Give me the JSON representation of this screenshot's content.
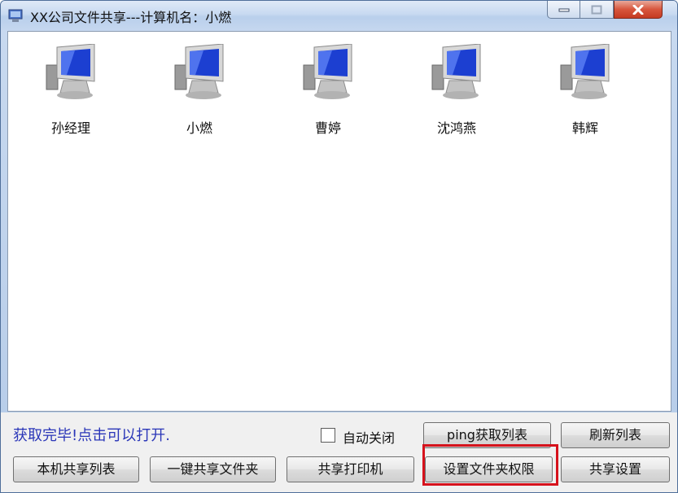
{
  "window": {
    "title": "XX公司文件共享---计算机名：小燃"
  },
  "computers": [
    {
      "name": "孙经理"
    },
    {
      "name": "小燃"
    },
    {
      "name": "曹婷"
    },
    {
      "name": "沈鸿燕"
    },
    {
      "name": "韩辉"
    }
  ],
  "status_text": "获取完毕!点击可以打开.",
  "auto_close": {
    "label": "自动关闭",
    "checked": false
  },
  "buttons": {
    "ping_list": "ping获取列表",
    "refresh_list": "刷新列表",
    "local_share_list": "本机共享列表",
    "one_click_share": "一键共享文件夹",
    "share_printer": "共享打印机",
    "folder_permission": "设置文件夹权限",
    "share_settings": "共享设置"
  }
}
